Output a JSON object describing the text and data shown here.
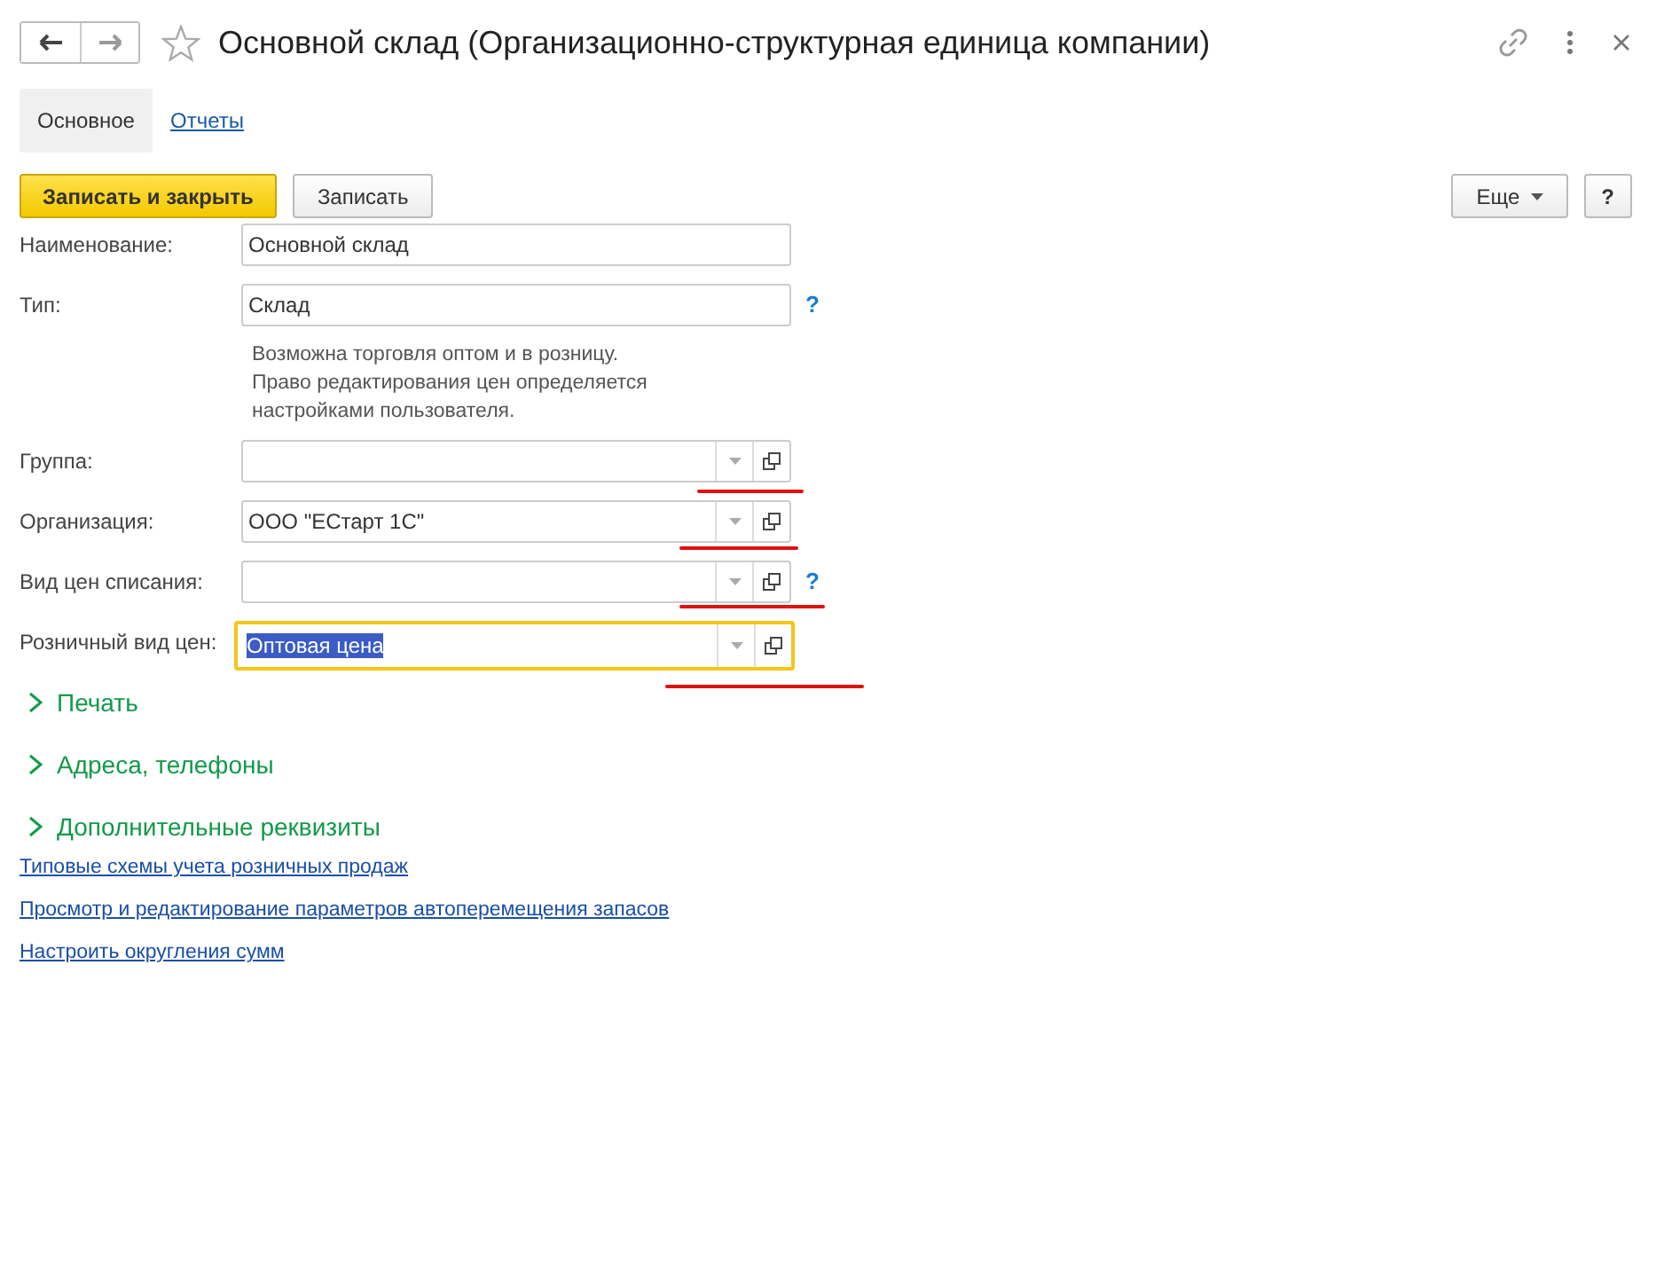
{
  "window": {
    "title": "Основной склад (Организационно-структурная единица компании)",
    "favorite": false
  },
  "tabs": [
    {
      "label": "Основное",
      "selected": true
    },
    {
      "label": "Отчеты",
      "selected": false
    }
  ],
  "toolbar": {
    "primary": "Записать и закрыть",
    "secondary": "Записать",
    "more": "Еще",
    "help": "?"
  },
  "fields": [
    {
      "kind": "text",
      "label": "Наименование:",
      "value": "Основной склад",
      "focused": false,
      "annotated": false
    },
    {
      "kind": "text",
      "label": "Тип:",
      "value": "Склад",
      "help_text": "?",
      "focused": false,
      "annotated": false,
      "note": [
        "Возможна торговля оптом и в розницу.",
        "Право редактирования цен определяется",
        "настройками пользователя."
      ]
    },
    {
      "kind": "select",
      "label": "Группа:",
      "focused": false,
      "annotated": true
    },
    {
      "kind": "select",
      "label": "Организация:",
      "value": "ООО \"ЕСтарт 1С\"",
      "focused": false,
      "annotated": true
    },
    {
      "kind": "select",
      "label": "Вид цен списания:",
      "help_text": "?",
      "focused": false,
      "annotated": true
    },
    {
      "kind": "select",
      "label": "Розничный вид цен:",
      "value": "Оптовая цена",
      "focused": true,
      "annotated": true
    }
  ],
  "sections": [
    {
      "label": "Печать",
      "expanded": false
    },
    {
      "label": "Адреса, телефоны",
      "expanded": false
    },
    {
      "label": "Дополнительные реквизиты",
      "expanded": false
    }
  ],
  "links": [
    "Типовые схемы учета розничных продаж",
    "Просмотр и редактирование параметров автоперемещения запасов",
    "Настроить округления сумм"
  ]
}
